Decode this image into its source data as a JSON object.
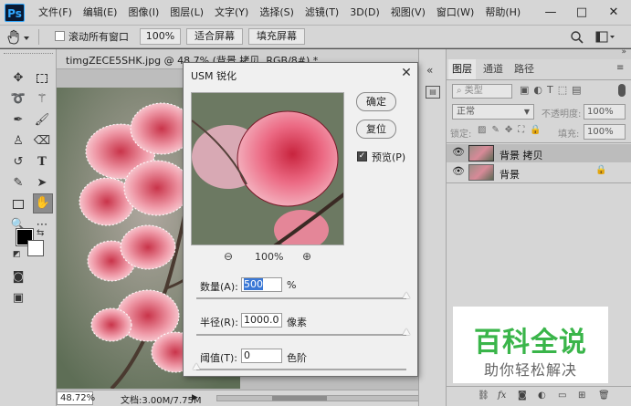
{
  "app": {
    "logo": "Ps"
  },
  "menu": [
    "文件(F)",
    "编辑(E)",
    "图像(I)",
    "图层(L)",
    "文字(Y)",
    "选择(S)",
    "滤镜(T)",
    "3D(D)",
    "视图(V)",
    "窗口(W)",
    "帮助(H)"
  ],
  "window_controls": {
    "minimize": "—",
    "maximize": "□",
    "close": "✕"
  },
  "options_bar": {
    "scroll_all_label": "滚动所有窗口",
    "zoom_100_label": "100%",
    "fit_screen_label": "适合屏幕",
    "fill_screen_label": "填充屏幕"
  },
  "document": {
    "tab_title": "timgZECE5SHK.jpg @ 48.7% (背景 拷贝, RGB/8#) *",
    "zoom": "48.72%",
    "doc_size": "文档:3.00M/7.75M"
  },
  "usm_dialog": {
    "title": "USM 锐化",
    "ok_label": "确定",
    "reset_label": "复位",
    "preview_label": "预览(P)",
    "preview_checked": true,
    "zoom_level": "100%",
    "amount_label": "数量(A):",
    "amount_value": "500",
    "amount_unit": "%",
    "amount_level": 1.0,
    "radius_label": "半径(R):",
    "radius_value": "1000.0",
    "radius_unit": "像素",
    "radius_level": 1.0,
    "threshold_label": "阈值(T):",
    "threshold_value": "0",
    "threshold_unit": "色阶",
    "threshold_level": 0.0
  },
  "layers_panel": {
    "tabs": [
      "图层",
      "通道",
      "路径"
    ],
    "kind_filter": "类型",
    "blend_mode": "正常",
    "opacity_label": "不透明度:",
    "opacity_value": "100%",
    "lock_label": "锁定:",
    "fill_label": "填充:",
    "fill_value": "100%",
    "layers": [
      {
        "name": "背景 拷贝",
        "selected": true,
        "locked": false
      },
      {
        "name": "背景",
        "selected": false,
        "locked": true
      }
    ]
  },
  "watermark": {
    "title": "百科全说",
    "subtitle": "助你轻松解决"
  },
  "colors": {
    "foreground": "#000000",
    "background": "#ffffff",
    "accent_green": "#3ab54a"
  }
}
